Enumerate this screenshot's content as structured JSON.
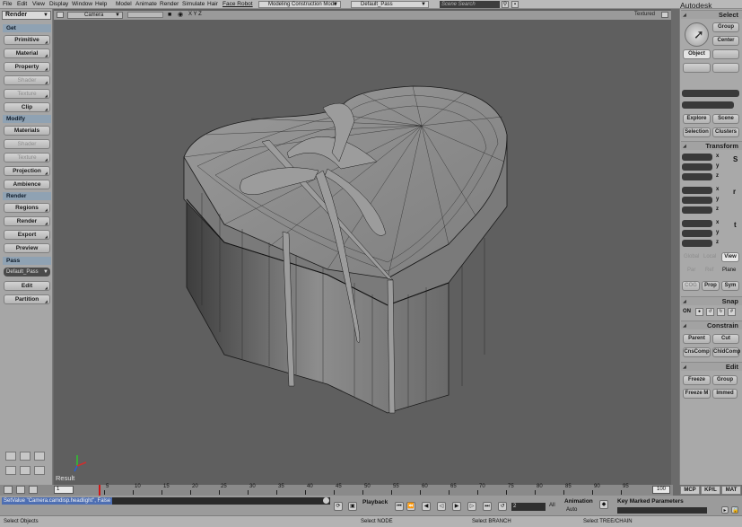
{
  "menu": {
    "items": [
      "File",
      "Edit",
      "View",
      "Display",
      "Window",
      "Help",
      "Model",
      "Animate",
      "Render",
      "Simulate",
      "Hair",
      "Face Robot"
    ],
    "layout_combo": "Modeling Construction Mode",
    "pass_combo": "Default_Pass",
    "search_placeholder": "Scene Search"
  },
  "brand": "Autodesk Softimage",
  "left_panel": {
    "mode": "Render",
    "sections": {
      "get": "Get",
      "modify": "Modify",
      "render": "Render",
      "pass": "Pass"
    },
    "get_buttons": [
      "Primitive",
      "Material",
      "Property",
      "Shader",
      "Texture",
      "Clip"
    ],
    "modify_buttons": [
      "Materials",
      "Shader",
      "Texture",
      "Projection",
      "Ambience"
    ],
    "render_buttons": [
      "Regions",
      "Render",
      "Export",
      "Preview"
    ],
    "pass_select": "Default_Pass",
    "pass_buttons": [
      "Edit",
      "Partition"
    ]
  },
  "viewport": {
    "camera": "Camera",
    "axes_label": "X Y Z",
    "display_mode": "Textured",
    "result_label": "Result"
  },
  "right_panel": {
    "select_title": "Select",
    "group": "Group",
    "center": "Center",
    "object": "Object",
    "explore": "Explore",
    "scene": "Scene",
    "selection": "Selection",
    "clusters": "Clusters",
    "transform_title": "Transform",
    "axes": [
      "x",
      "y",
      "z"
    ],
    "srt": [
      "S",
      "r",
      "t"
    ],
    "global": "Global",
    "local": "Local",
    "view": "View",
    "par": "Par",
    "ref": "Ref",
    "plane": "Plane",
    "cog": "COG",
    "prop": "Prop",
    "sym": "Sym",
    "snap_title": "Snap",
    "snap_on": "ON",
    "constrain_title": "Constrain",
    "parent": "Parent",
    "cut": "Cut",
    "cnscomp": "CnsComp",
    "childcomp": "ChldComp",
    "edit_title": "Edit",
    "freeze": "Freeze",
    "edit_group": "Group",
    "freeze_m": "Freeze M",
    "immed": "Immed"
  },
  "timeline": {
    "start": "1",
    "end": "100",
    "labels": [
      "5",
      "10",
      "15",
      "20",
      "25",
      "30",
      "35",
      "40",
      "45",
      "50",
      "55",
      "60",
      "65",
      "70",
      "75",
      "80",
      "85",
      "90",
      "95"
    ],
    "current_frame": 5
  },
  "command": {
    "text": "SetValue \"Camera.camdisp.headlight\", False",
    "playback": "Playback",
    "animation": "Animation",
    "auto": "Auto",
    "key_marked": "Key Marked Parameters",
    "frame_field": "2",
    "all": "All"
  },
  "tabs": [
    "MCP",
    "KP/L",
    "MAT"
  ],
  "status": {
    "left": "Select Objects",
    "mid1": "Select NODE",
    "mid2": "Select BRANCH",
    "right": "Select TREE/CHAIN"
  }
}
